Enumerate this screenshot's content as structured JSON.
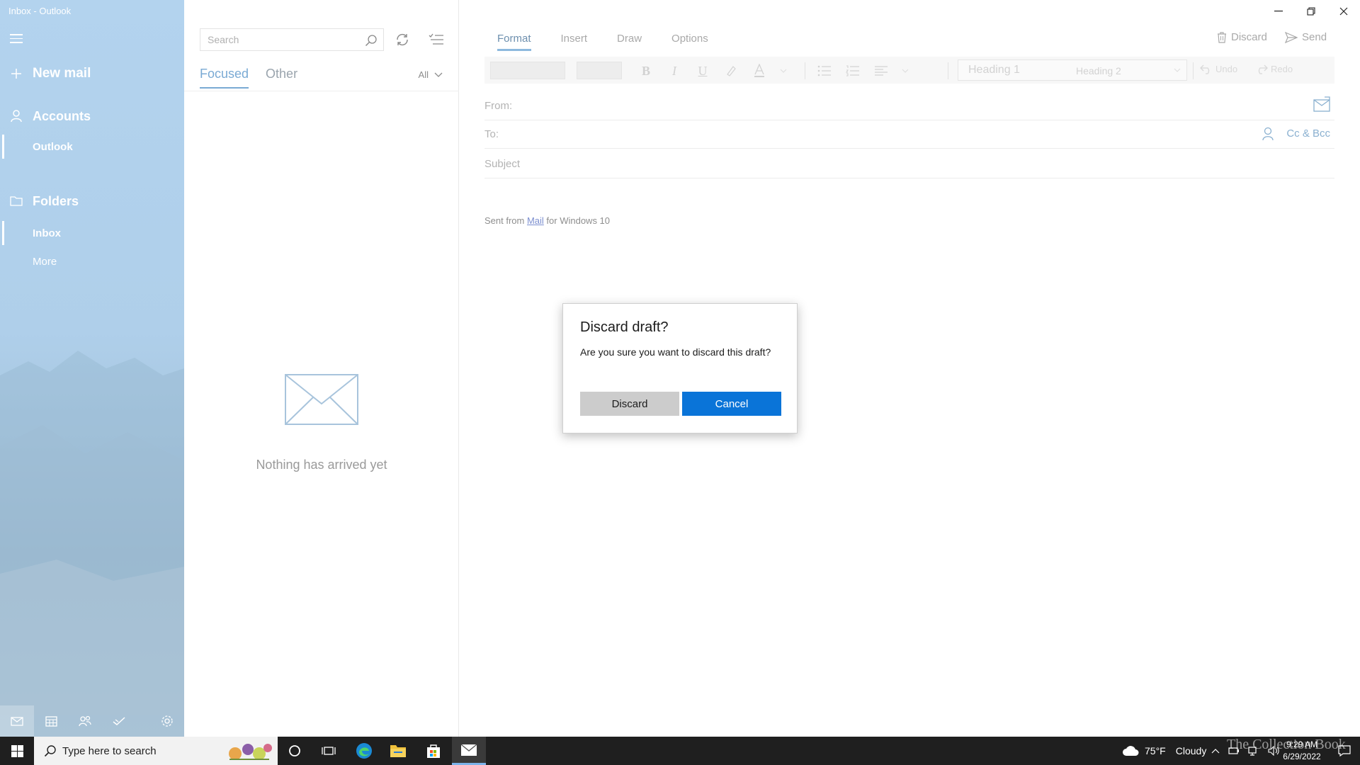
{
  "window": {
    "title": "Inbox - Outlook"
  },
  "nav": {
    "new_mail": "New mail",
    "accounts": "Accounts",
    "account_name": "Outlook",
    "folders": "Folders",
    "folder_inbox": "Inbox",
    "more": "More"
  },
  "list": {
    "search_placeholder": "Search",
    "tab_focused": "Focused",
    "tab_other": "Other",
    "filter_all": "All",
    "empty_message": "Nothing has arrived yet"
  },
  "compose": {
    "tabs": [
      "Format",
      "Insert",
      "Draw",
      "Options"
    ],
    "discard": "Discard",
    "send": "Send",
    "toolbar": {
      "bold": "B",
      "italic": "I",
      "underline": "U",
      "style_heading1": "Heading 1",
      "style_heading2": "Heading 2",
      "undo": "Undo",
      "redo": "Redo"
    },
    "from_label": "From:",
    "to_label": "To:",
    "cc_bcc": "Cc & Bcc",
    "subject_placeholder": "Subject",
    "signature_prefix": "Sent from ",
    "signature_link": "Mail",
    "signature_suffix": " for Windows 10"
  },
  "dialog": {
    "title": "Discard draft?",
    "message": "Are you sure you want to discard this draft?",
    "discard_button": "Discard",
    "cancel_button": "Cancel"
  },
  "taskbar": {
    "search_placeholder": "Type here to search",
    "weather_temp": "75°F",
    "weather_desc": "Cloudy",
    "time": "9:29 AM",
    "date": "6/29/2022",
    "watermark": "The Collection Book"
  },
  "icons": {
    "hamburger": "hamburger-menu-icon",
    "new_mail": "plus-icon",
    "accounts": "person-icon",
    "folders": "folder-icon",
    "search": "search-icon",
    "sync": "sync-icon",
    "filter": "selection-mode-icon",
    "empty": "envelope-icon",
    "discard": "trash-icon",
    "send": "send-icon"
  },
  "colors": {
    "accent": "#0a74d8",
    "nav_bg": "#b3d3ee",
    "taskbar_bg": "#1f1f1f",
    "tab_active": "#7aaad4"
  }
}
